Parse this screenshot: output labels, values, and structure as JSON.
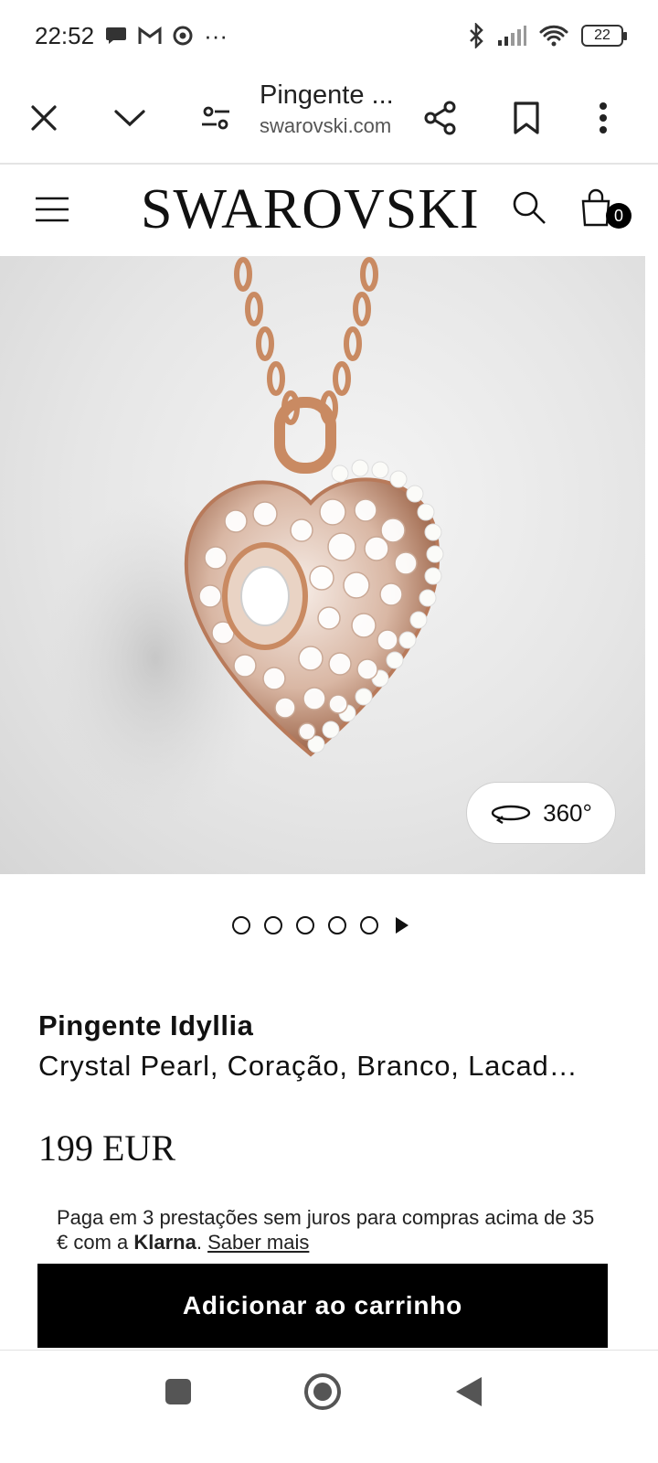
{
  "status_bar": {
    "time": "22:52",
    "overflow": "···",
    "battery": "22"
  },
  "browser": {
    "tab_title": "Pingente ...",
    "domain": "swarovski.com"
  },
  "site": {
    "logo": "SWAROVSKI",
    "cart_count": "0"
  },
  "gallery": {
    "view_360_label": "360°",
    "dot_count": 5
  },
  "product": {
    "name": "Pingente Idyllia",
    "description": "Crystal Pearl, Coração, Branco, Lacad…",
    "price": "199 EUR"
  },
  "klarna": {
    "text_before": "Paga em 3 prestações sem juros para compras acima de 35 € com a ",
    "brand": "Klarna",
    "text_after": ". ",
    "link": "Saber mais"
  },
  "cta": {
    "add_to_cart": "Adicionar ao carrinho"
  },
  "colors": {
    "accent": "#000000",
    "gold": "#c98a62"
  }
}
